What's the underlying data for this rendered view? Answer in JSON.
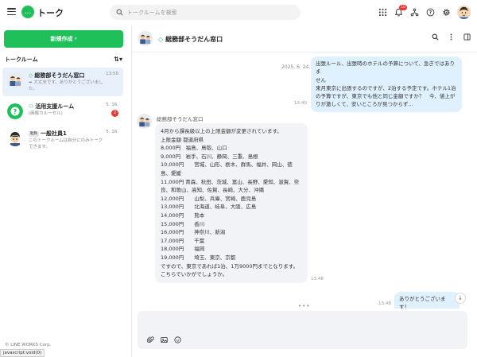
{
  "app": {
    "title": "トーク"
  },
  "search": {
    "placeholder": "トークルームを検索"
  },
  "topbar": {
    "notification_count": "10"
  },
  "sidebar": {
    "new_button": "新規作成",
    "section_title": "トークルーム",
    "rooms": [
      {
        "title": "総務部そうだん窓口",
        "time": "13:50",
        "preview": "大丈夫です。ありがとうございました。"
      },
      {
        "title": "活用支援ルーム",
        "time": "5. 16.",
        "preview": "(画像カルーセル)",
        "badge": "2"
      },
      {
        "tag": "社外",
        "title": "一般社員1",
        "time": "5. 16.",
        "preview": "このトークルームは自分にのみトークできます。"
      }
    ],
    "copyright": "© LINE WORKS Corp."
  },
  "chat": {
    "title": "総務部そうだん窓口",
    "date": "2025. 6. 24. (火)",
    "messages": [
      {
        "lines": [
          "出張ルール、出張時のホテルの予算について、急ぎではありま",
          "せん",
          "来月東京に出張するのですが、2泊する予定です。ホテル1泊",
          "の予算ですが、東京でも他と同じ金額ですか？　今、値上が",
          "りが激しくて、安いところが見つからず…"
        ],
        "time": "13:40"
      },
      {
        "sender": "総務部そうだん窓口",
        "text": "4月から課長級以上の上限金額が変更されています。\n上限金額 都道府県\n8,000円　福島、鳥取、山口\n9,000円　岩手、石川、静岡、三重、島根\n10,000円　　宮城、山形、栃木、群馬、福井、岡山、徳島、愛媛\n11,000円 青森、秋田、茨城、富山、長野、愛知、滋賀、奈良、和歌山、高知、佐賀、長崎、大分、沖縄\n12,000円　　山梨、兵庫、宮崎、鹿児島\n13,000円　　北海道、岐阜、大阪、広島\n14,000円　　熊本\n15,000円　　香川\n16,000円　　神奈川、新潟\n17,000円　　千葉\n18,000円　　福岡\n19,000円　　埼玉、東京、京都\nですので、東京であれば1泊、1万9000円までとなります。\nこちらでいかがでしょうか。",
        "time": "13:48"
      },
      {
        "text": "ありがとうございます！",
        "time": "13:48"
      }
    ]
  },
  "statusbar": {
    "text": "javascript:void(0)"
  },
  "colors": {
    "brand": "#1fbf5a",
    "my_bubble": "#dff0ff",
    "other_bubble": "#f1f3f6",
    "badge": "#e53935"
  }
}
